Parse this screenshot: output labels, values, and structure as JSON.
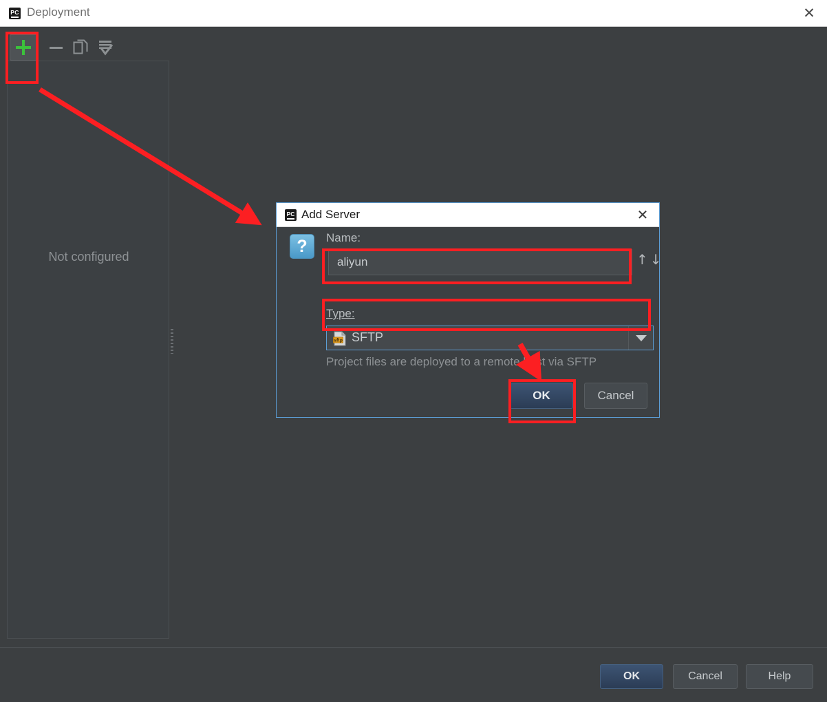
{
  "window": {
    "title": "Deployment",
    "app_icon": "pycharm-icon",
    "close_label": "✕"
  },
  "toolbar": {
    "add_label": "+",
    "add_name": "add-server-button",
    "remove_label": "–",
    "copy_label": "copy",
    "default_label": "set-default"
  },
  "server_list": {
    "empty_text": "Not configured"
  },
  "bottom_bar": {
    "ok_label": "OK",
    "cancel_label": "Cancel",
    "help_label": "Help"
  },
  "dialog": {
    "title": "Add Server",
    "close_label": "✕",
    "help_glyph": "?",
    "name_label": "Name:",
    "name_value": "aliyun",
    "name_placeholder": "",
    "reorder_up": "↑",
    "reorder_down": "↓",
    "type_label": "Type:",
    "type_value": "SFTP",
    "type_icon_badge": "sftp",
    "type_caret": "▼",
    "description": "Project files are deployed to a remote host via SFTP",
    "ok_label": "OK",
    "cancel_label": "Cancel"
  },
  "annotations": {
    "highlight_color": "#fc1f22",
    "arrow_add_to_dialog": "arrow from add button to Add Server dialog",
    "arrow_to_ok": "arrow pointing at dialog OK button"
  },
  "colors": {
    "accent_blue": "#5c9ed6",
    "plus_green": "#3cc13c",
    "annotation_red": "#fc1f22",
    "panel_bg": "#3c4043",
    "window_bg": "#3c3f41"
  }
}
